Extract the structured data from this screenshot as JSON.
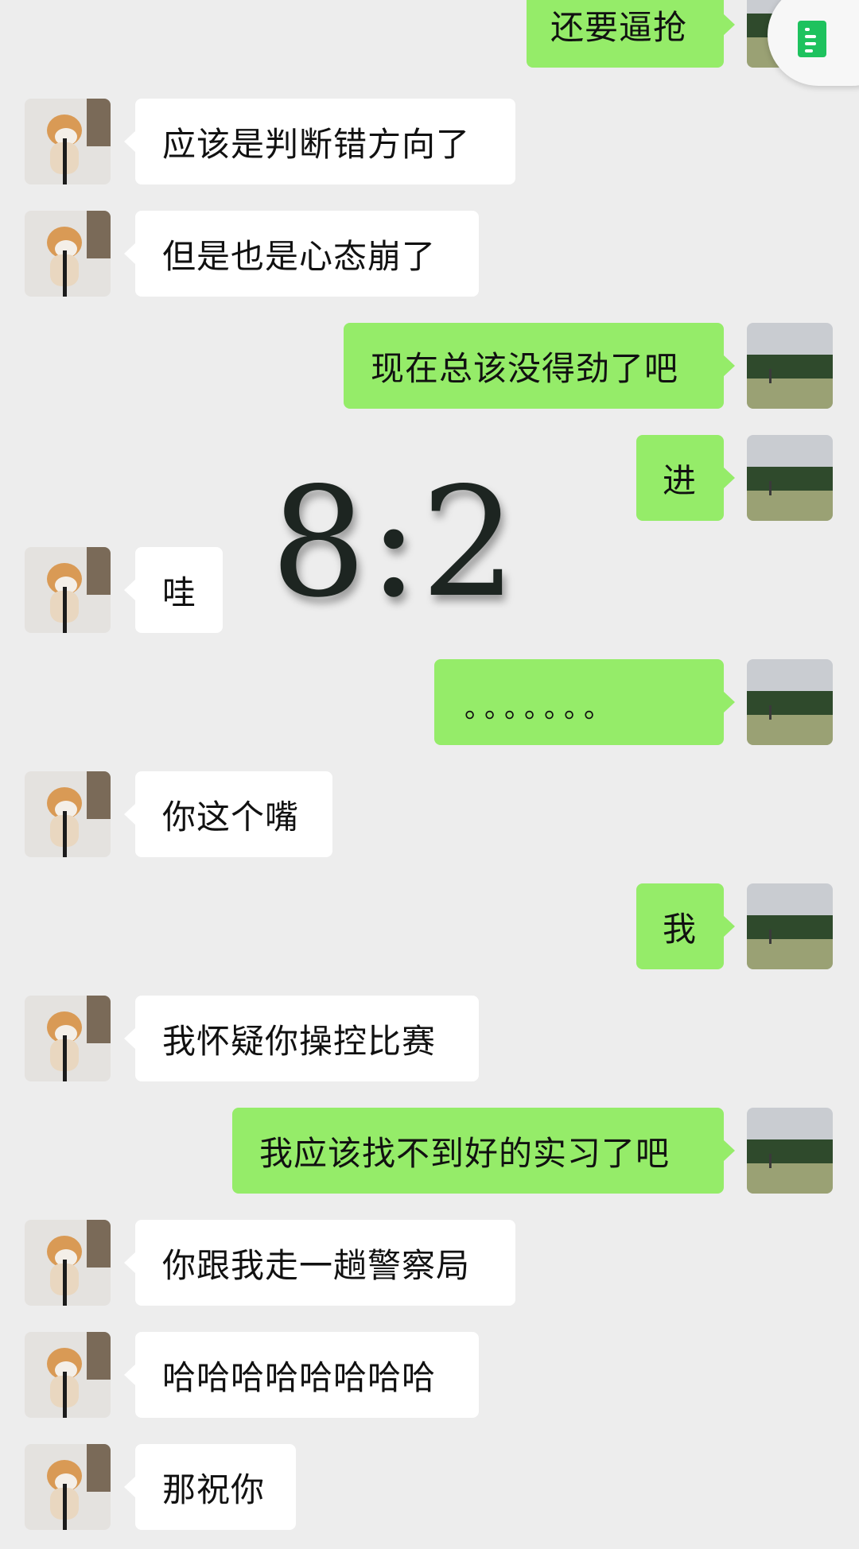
{
  "chat": {
    "messages": [
      {
        "side": "out",
        "text": "还要逼抢"
      },
      {
        "side": "in",
        "text": "应该是判断错方向了"
      },
      {
        "side": "in",
        "text": "但是也是心态崩了"
      },
      {
        "side": "out",
        "text": "现在总该没得劲了吧"
      },
      {
        "side": "out",
        "text": "进"
      },
      {
        "side": "in",
        "text": "哇"
      },
      {
        "side": "out",
        "text": "。。。。。。。"
      },
      {
        "side": "in",
        "text": "你这个嘴"
      },
      {
        "side": "out",
        "text": "我"
      },
      {
        "side": "in",
        "text": "我怀疑你操控比赛"
      },
      {
        "side": "out",
        "text": "我应该找不到好的实习了吧"
      },
      {
        "side": "in",
        "text": "你跟我走一趟警察局"
      },
      {
        "side": "in",
        "text": "哈哈哈哈哈哈哈哈"
      },
      {
        "side": "in",
        "text": "那祝你"
      }
    ]
  },
  "overlay": {
    "score_text": "8:2"
  },
  "floating_button": {
    "icon": "document-icon",
    "accent_color": "#1ec25e"
  },
  "colors": {
    "background": "#ededed",
    "outgoing_bubble": "#95ec69",
    "incoming_bubble": "#ffffff"
  }
}
